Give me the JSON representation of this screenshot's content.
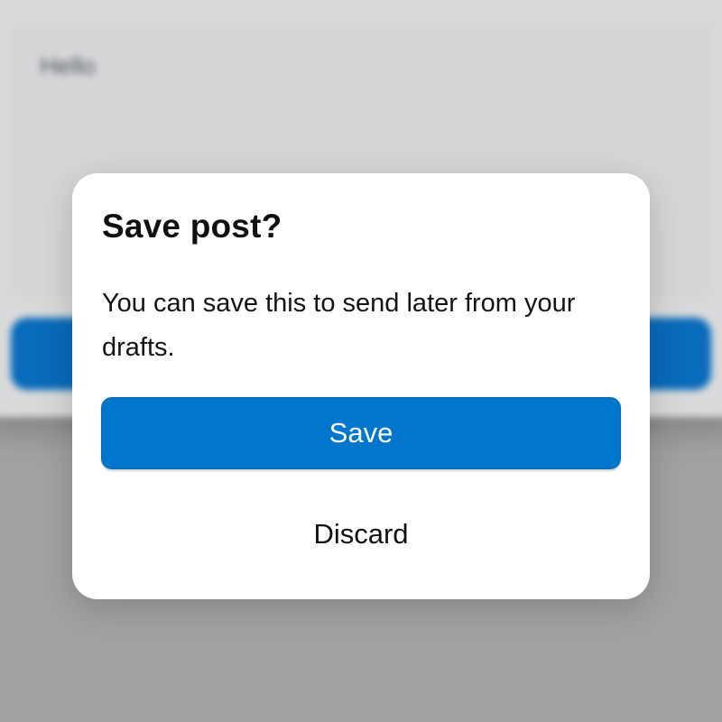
{
  "background": {
    "compose_text": "Hello"
  },
  "dialog": {
    "title": "Save post?",
    "message": "You can save this to send later from your drafts.",
    "save_label": "Save",
    "discard_label": "Discard"
  },
  "colors": {
    "primary": "#0077cc",
    "dialog_bg": "#ffffff",
    "backdrop": "#adadad"
  }
}
